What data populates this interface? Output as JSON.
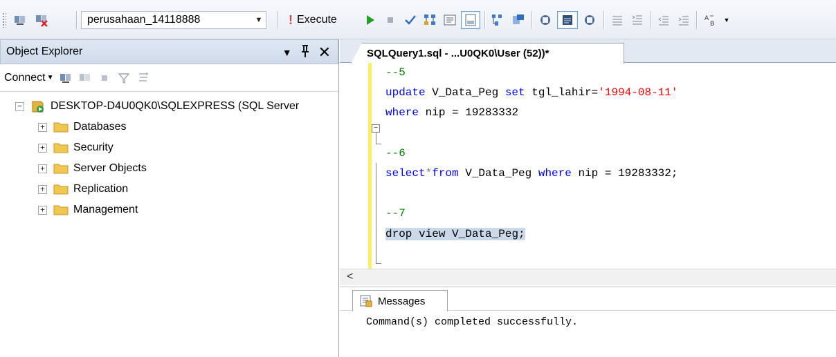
{
  "toolbar": {
    "database": "perusahaan_14118888",
    "execute_label": "Execute"
  },
  "object_explorer": {
    "title": "Object Explorer",
    "pin_glyph": "↓",
    "close_glyph": "✕",
    "dropdown_glyph": "▼",
    "connect_label": "Connect",
    "server": "DESKTOP-D4U0QK0\\SQLEXPRESS (SQL Server",
    "folders": [
      "Databases",
      "Security",
      "Server Objects",
      "Replication",
      "Management"
    ]
  },
  "editor": {
    "tab_title": "SQLQuery1.sql - ...U0QK0\\User (52))*",
    "lines": {
      "l1": "--5",
      "l2a": "update",
      "l2b": " V_Data_Peg ",
      "l2c": "set",
      "l2d": " tgl_lahir=",
      "l2e": "'1994-08-11'",
      "l3a": "where",
      "l3b": " nip = 19283332",
      "l5": "--6",
      "l6a": "select",
      "l6b": "*",
      "l6c": "from",
      "l6d": " V_Data_Peg ",
      "l6e": "where",
      "l6f": " nip = 19283332;",
      "l8": "--7",
      "l9a": "drop",
      "l9b": " ",
      "l9c": "view",
      "l9d": " V_Data_Peg;"
    }
  },
  "results": {
    "tab_label": "Messages",
    "message": "Command(s) completed successfully."
  },
  "colors": {
    "comment": "#008000",
    "keyword": "#0000ff",
    "string": "#ff0000",
    "selection": "#c9d9ea",
    "change_margin": "#ffee62"
  }
}
